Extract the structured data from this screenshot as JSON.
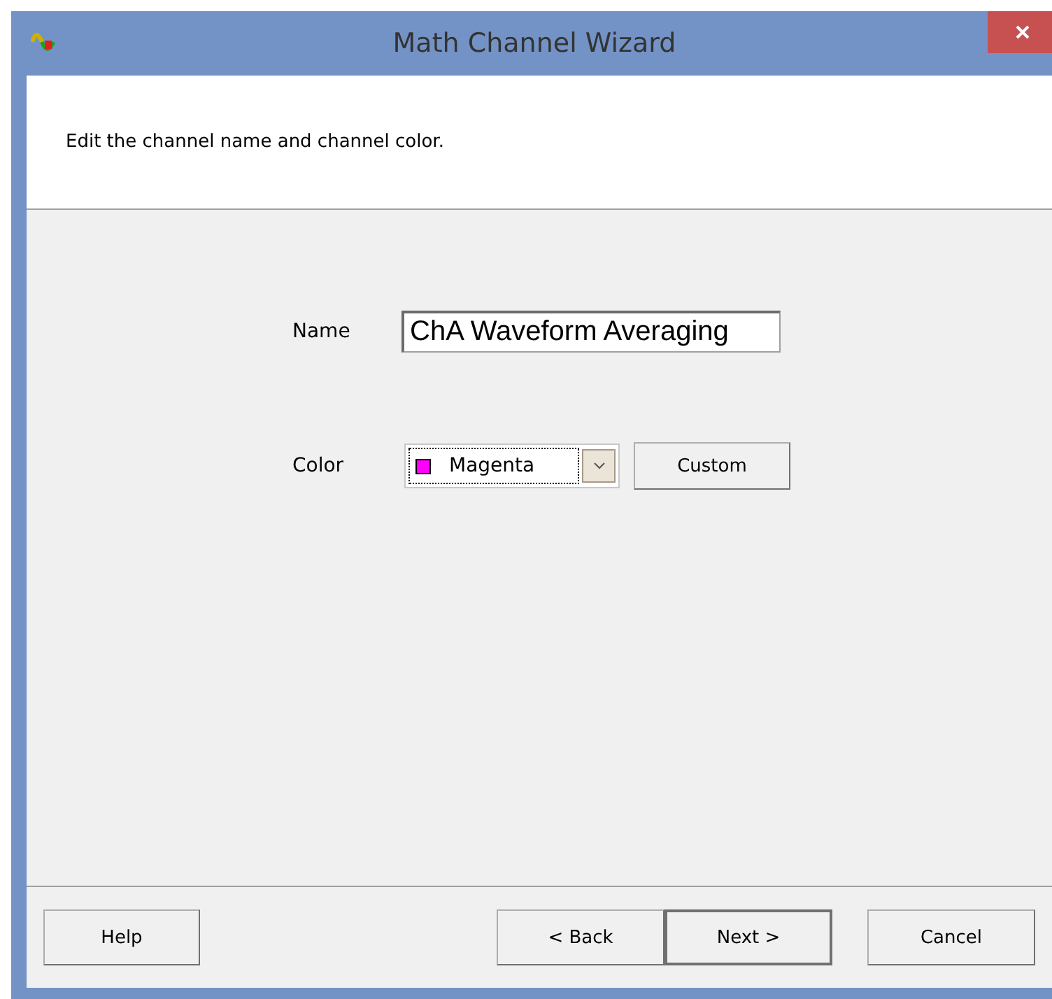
{
  "window": {
    "title": "Math Channel Wizard"
  },
  "header": {
    "instruction": "Edit the channel name and channel color."
  },
  "name_field": {
    "label": "Name",
    "value": "ChA Waveform Averaging"
  },
  "color_field": {
    "label": "Color",
    "value": "Magenta",
    "color": "#ff00ff"
  },
  "custom_button": {
    "label": "Custom"
  },
  "footer": {
    "help_button": {
      "label": "Help",
      "default": false
    },
    "navigation_buttons": [
      {
        "label": "< Back",
        "default": false
      },
      {
        "label": "Next >",
        "default": true
      }
    ],
    "cancel_button": {
      "label": "Cancel",
      "default": false
    }
  }
}
